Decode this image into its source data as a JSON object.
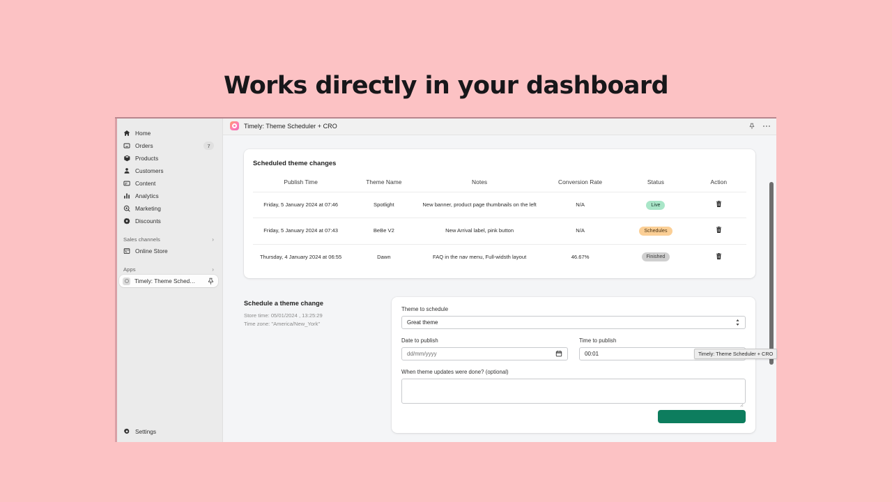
{
  "headline": "Works directly in your dashboard",
  "colors": {
    "page_background": "#fcc2c4",
    "sidebar": "#ebebeb",
    "content": "#f4f5f7",
    "accent_green": "#0d7d5e",
    "pill_live": "#a9e6c8",
    "pill_scheduled": "#fbcf96",
    "pill_finished": "#cfcfcf"
  },
  "sidebar": {
    "items": [
      {
        "label": "Home",
        "icon": "home-icon"
      },
      {
        "label": "Orders",
        "icon": "orders-icon",
        "badge": "7"
      },
      {
        "label": "Products",
        "icon": "products-icon"
      },
      {
        "label": "Customers",
        "icon": "customers-icon"
      },
      {
        "label": "Content",
        "icon": "content-icon"
      },
      {
        "label": "Analytics",
        "icon": "analytics-icon"
      },
      {
        "label": "Marketing",
        "icon": "marketing-icon"
      },
      {
        "label": "Discounts",
        "icon": "discounts-icon"
      }
    ],
    "sections": [
      {
        "label": "Sales channels",
        "chevron": "›"
      },
      {
        "label": "Apps",
        "chevron": "›"
      }
    ],
    "online_store": {
      "label": "Online Store",
      "icon": "store-icon"
    },
    "app_item": {
      "label": "Timely: Theme Sched…",
      "icon": "app-icon",
      "pin": "pin-icon"
    },
    "settings": {
      "label": "Settings",
      "icon": "gear-icon"
    }
  },
  "topbar": {
    "title": "Timely: Theme Scheduler + CRO",
    "pin_icon": "pin-icon",
    "more_icon": "ellipsis-icon"
  },
  "scheduled_card": {
    "title": "Scheduled theme changes",
    "columns": [
      "Publish Time",
      "Theme Name",
      "Notes",
      "Conversion Rate",
      "Status",
      "Action"
    ],
    "rows": [
      {
        "publish_time": "Friday, 5 January 2024 at 07:46",
        "theme_name": "Spotlight",
        "notes": "New banner, product page thumbnails on the left",
        "conversion_rate": "N/A",
        "status": "Live",
        "status_kind": "live",
        "action": "delete-icon"
      },
      {
        "publish_time": "Friday, 5 January 2024 at 07:43",
        "theme_name": "BeBe V2",
        "notes": "New Arrival label, pink button",
        "conversion_rate": "N/A",
        "status": "Schedules",
        "status_kind": "scheduled",
        "action": "delete-icon"
      },
      {
        "publish_time": "Thursday, 4 January 2024 at 06:55",
        "theme_name": "Dawn",
        "notes": "FAQ in the nav menu, Full-widsth layout",
        "conversion_rate": "46.67%",
        "status": "Finished",
        "status_kind": "finished",
        "action": "delete-icon"
      }
    ]
  },
  "schedule_form": {
    "heading": "Schedule a theme change",
    "store_time": "Store time: 05/01/2024 , 13:25:29",
    "time_zone": "Time zone: \"America/New_York\"",
    "theme_label": "Theme to schedule",
    "theme_value": "Great theme",
    "date_label": "Date to publish",
    "date_placeholder": "dd/mm/yyyy",
    "time_label": "Time to publish",
    "time_value": "00:01",
    "notes_label": "When theme updates were done? (optional)",
    "notes_value": "",
    "submit_label": ""
  },
  "tooltip": {
    "text": "Timely: Theme Scheduler + CRO"
  }
}
